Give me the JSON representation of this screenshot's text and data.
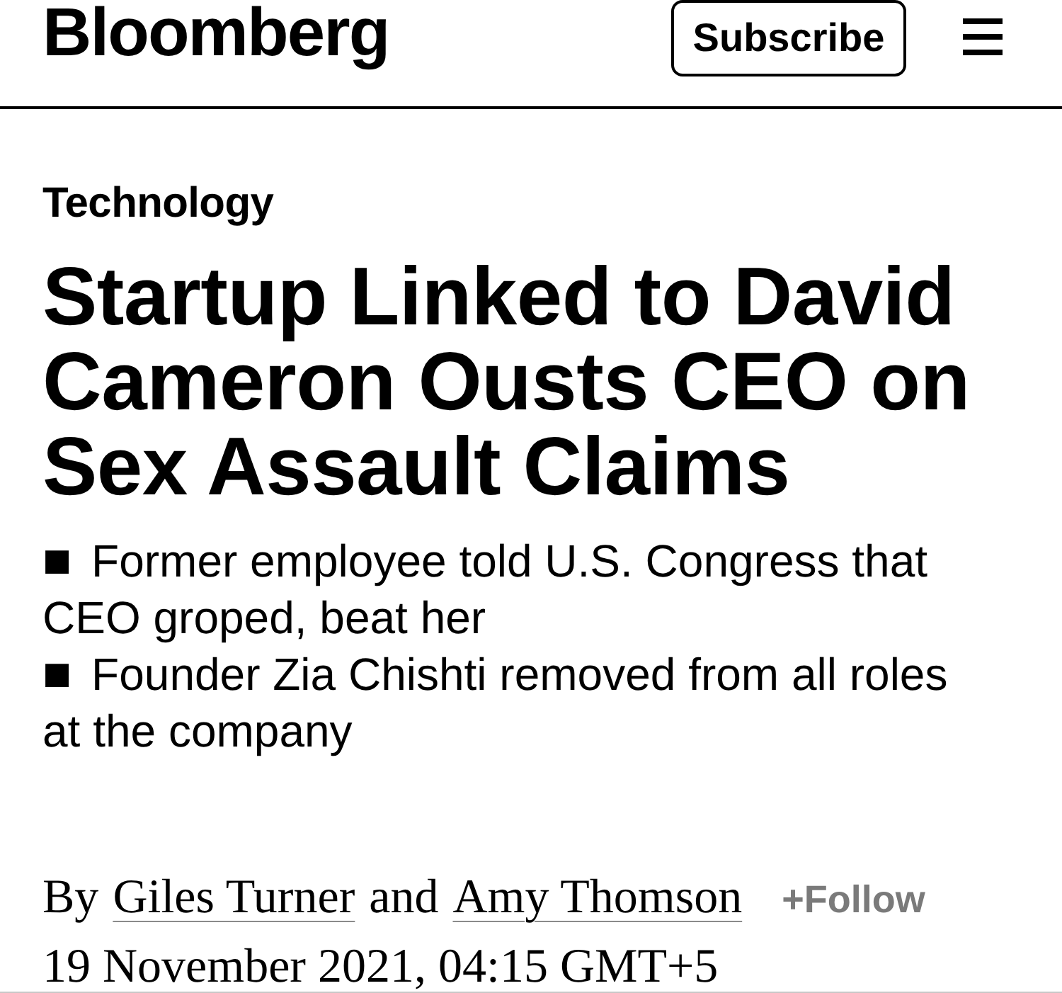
{
  "header": {
    "logo": "Bloomberg",
    "subscribe_button": "Subscribe"
  },
  "article": {
    "section": "Technology",
    "headline": "Startup Linked to David Cameron Ousts CEO on Sex Assault Claims",
    "bullets": [
      {
        "marker": "■",
        "text": "Former employee told U.S. Congress that CEO groped, beat her"
      },
      {
        "marker": "■",
        "text": "Founder Zia Chishti removed from all roles at the company"
      }
    ],
    "byline": {
      "prefix": "By",
      "authors": [
        "Giles Turner",
        "Amy Thomson"
      ],
      "conjunction": "and",
      "follow_button": "+Follow"
    },
    "date": "19 November 2021, 04:15 GMT+5"
  }
}
